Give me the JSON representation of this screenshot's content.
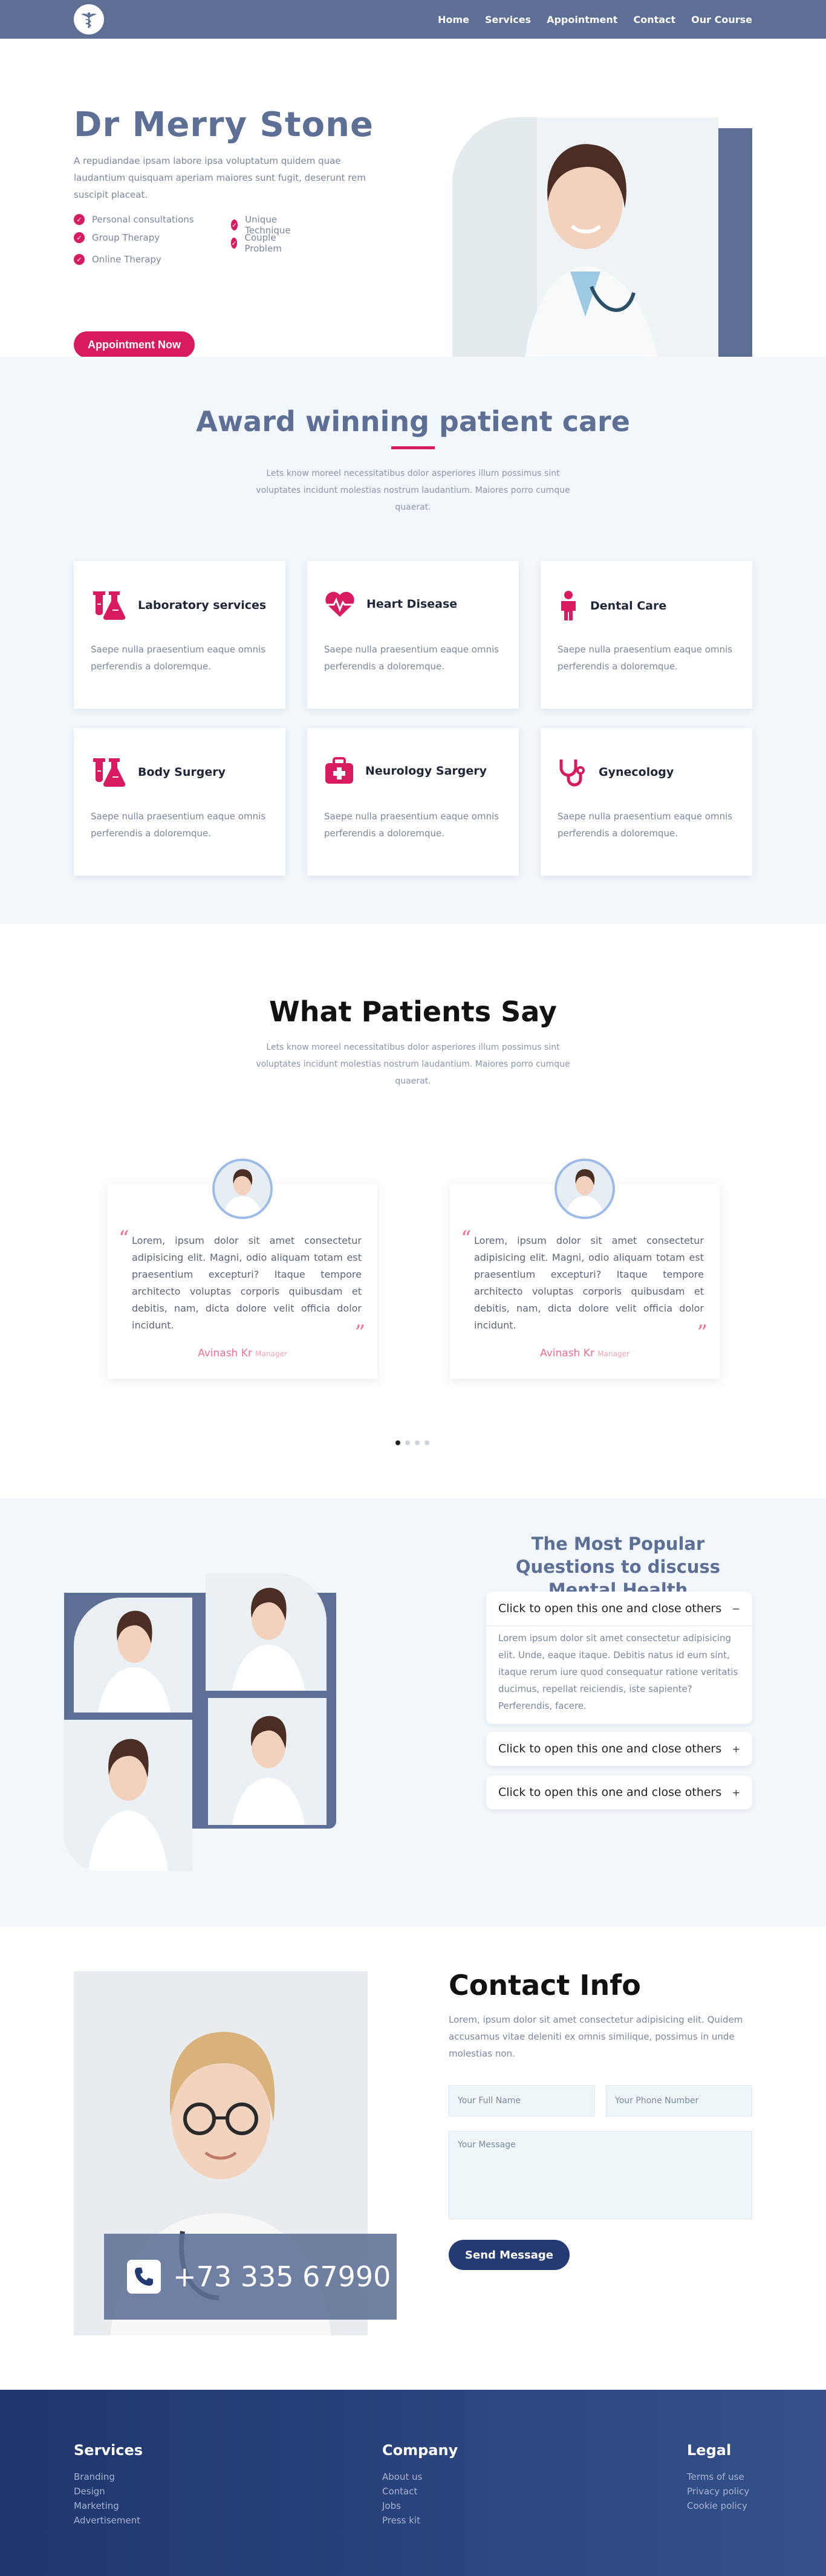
{
  "nav": {
    "links": [
      "Home",
      "Services",
      "Appointment",
      "Contact",
      "Our Course"
    ]
  },
  "hero": {
    "title": "Dr Merry Stone",
    "description": "A repudiandae ipsam labore ipsa voluptatum quidem quae laudantium quisquam aperiam maiores sunt fugit, deserunt rem suscipit placeat.",
    "features": [
      "Personal consultations",
      "Unique Technique",
      "Group Therapy",
      "Couple Problem",
      "Online Therapy"
    ],
    "button": "Appointment Now"
  },
  "award": {
    "title": "Award winning patient care",
    "subtitle": "Lets know moreel necessitatibus dolor asperiores illum possimus sint voluptates incidunt molestias nostrum laudantium. Maiores porro cumque quaerat.",
    "cards": [
      {
        "title": "Laboratory services",
        "text": "Saepe nulla praesentium eaque omnis perferendis a doloremque.",
        "icon": "flask-icon"
      },
      {
        "title": "Heart Disease",
        "text": "Saepe nulla praesentium eaque omnis perferendis a doloremque.",
        "icon": "heartbeat-icon"
      },
      {
        "title": "Dental Care",
        "text": "Saepe nulla praesentium eaque omnis perferendis a doloremque.",
        "icon": "person-icon"
      },
      {
        "title": "Body Surgery",
        "text": "Saepe nulla praesentium eaque omnis perferendis a doloremque.",
        "icon": "flask-icon"
      },
      {
        "title": "Neurology Sargery",
        "text": "Saepe nulla praesentium eaque omnis perferendis a doloremque.",
        "icon": "medkit-icon"
      },
      {
        "title": "Gynecology",
        "text": "Saepe nulla praesentium eaque omnis perferendis a doloremque.",
        "icon": "stethoscope-icon"
      }
    ]
  },
  "testimonials": {
    "title": "What Patients Say",
    "subtitle": "Lets know moreel necessitatibus dolor asperiores illum possimus sint voluptates incidunt molestias nostrum laudantium. Maiores porro cumque quaerat.",
    "items": [
      {
        "text": "Lorem, ipsum dolor sit amet consectetur adipisicing elit. Magni, odio aliquam totam est praesentium excepturi? Itaque tempore architecto voluptas corporis quibusdam et debitis, nam, dicta dolore velit officia dolor incidunt.",
        "name": "Avinash Kr",
        "role": "Manager"
      },
      {
        "text": "Lorem, ipsum dolor sit amet consectetur adipisicing elit. Magni, odio aliquam totam est praesentium excepturi? Itaque tempore architecto voluptas corporis quibusdam et debitis, nam, dicta dolore velit officia dolor incidunt.",
        "name": "Avinash Kr",
        "role": "Manager"
      }
    ]
  },
  "faq": {
    "title": "The Most Popular Questions to discuss Mental Health",
    "items": [
      {
        "question": "Click to open this one and close others",
        "sign": "−",
        "answer": "Lorem ipsum dolor sit amet consectetur adipisicing elit. Unde, eaque itaque. Debitis natus id eum sint, itaque rerum iure quod consequatur ratione veritatis ducimus, repellat reiciendis, iste sapiente? Perferendis, facere."
      },
      {
        "question": "Click to open this one and close others",
        "sign": "+"
      },
      {
        "question": "Click to open this one and close others",
        "sign": "+"
      }
    ]
  },
  "contact": {
    "phone": "+73 335 67990",
    "title": "Contact Info",
    "description": "Lorem, ipsum dolor sit amet consectetur adipisicing elit. Quidem accusamus vitae deleniti ex omnis similique, possimus in unde molestias non.",
    "name_placeholder": "Your Full Name",
    "phone_placeholder": "Your Phone Number",
    "message_placeholder": "Your Message",
    "button": "Send Message"
  },
  "footer": {
    "columns": [
      {
        "title": "Services",
        "links": [
          "Branding",
          "Design",
          "Marketing",
          "Advertisement"
        ]
      },
      {
        "title": "Company",
        "links": [
          "About us",
          "Contact",
          "Jobs",
          "Press kit"
        ]
      },
      {
        "title": "Legal",
        "links": [
          "Terms of use",
          "Privacy policy",
          "Cookie policy"
        ]
      }
    ]
  },
  "colors": {
    "primary": "#5d6f95",
    "accent": "#d81b60",
    "navy": "#243a73",
    "light": "#f1f7fb"
  }
}
